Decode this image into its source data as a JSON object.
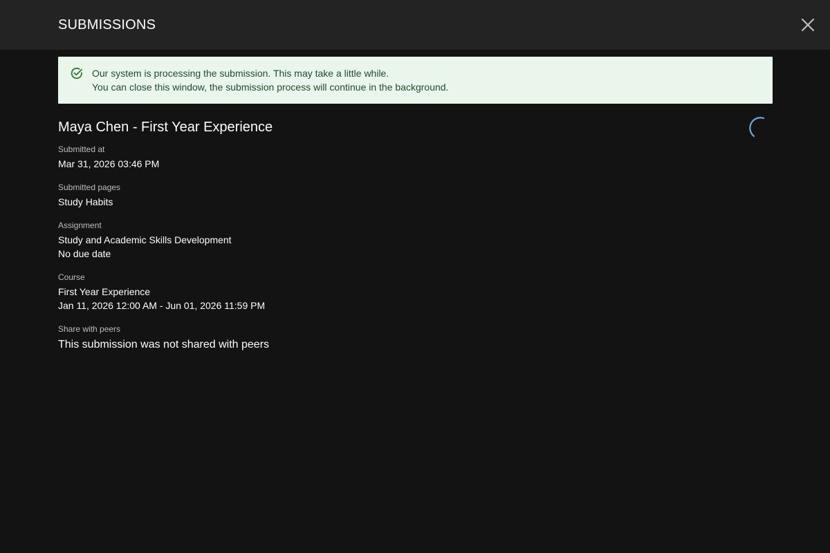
{
  "header": {
    "title": "SUBMISSIONS",
    "close_icon": "close-icon"
  },
  "notice": {
    "icon": "check-circle-icon",
    "line1": "Our system is processing the submission. This may take a little while.",
    "line2": "You can close this window, the submission process will continue in the background.",
    "colors": {
      "background": "#eaf5ec",
      "text": "#1f4d2b",
      "icon": "#2e7d32"
    }
  },
  "status": {
    "spinner_icon": "loading-spinner-icon",
    "spinner_color": "#6fa8dc"
  },
  "submission": {
    "title": "Maya Chen - First Year Experience",
    "submitted_at_label": "Submitted at",
    "submitted_at_value": "Mar 31, 2026 03:46 PM",
    "submitted_pages_label": "Submitted pages",
    "submitted_pages_value": "Study Habits",
    "assignment_label": "Assignment",
    "assignment_name": "Study and Academic Skills Development",
    "assignment_due": "No due date",
    "course_label": "Course",
    "course_name": "First Year Experience",
    "course_dates": "Jan 11, 2026 12:00 AM - Jun 01, 2026 11:59 PM",
    "share_label": "Share with peers",
    "share_value": "This submission was not shared with peers"
  }
}
